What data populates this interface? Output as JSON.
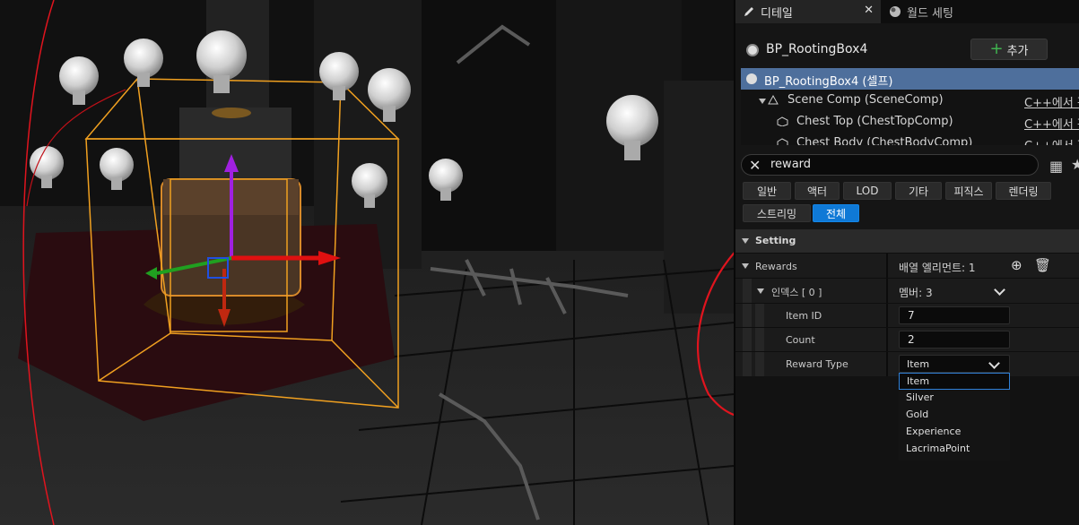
{
  "tabs": [
    {
      "label": "디테일",
      "active": true,
      "icon": "pencil-icon"
    },
    {
      "label": "월드 세팅",
      "active": false,
      "icon": "globe-icon"
    }
  ],
  "object": {
    "name": "BP_RootingBox4",
    "add_label": "추가"
  },
  "components": [
    {
      "label": "BP_RootingBox4 (셀프)",
      "selected": true,
      "cpp": ""
    },
    {
      "label": "Scene Comp (SceneComp)",
      "selected": false,
      "cpp": "C++에서 편"
    },
    {
      "label": "Chest Top (ChestTopComp)",
      "selected": false,
      "cpp": "C++에서 편"
    },
    {
      "label": "Chest Body (ChestBodyComp)",
      "selected": false,
      "cpp": "C++에서 편"
    }
  ],
  "search": {
    "value": "reward"
  },
  "filters": [
    "일반",
    "액터",
    "LOD",
    "기타",
    "피직스",
    "렌더링",
    "스트리밍",
    "전체"
  ],
  "active_filter": "전체",
  "section": "Setting",
  "properties": {
    "rewards_label": "Rewards",
    "rewards_value": "배열 엘리먼트: 1",
    "index_label": "인덱스 [ 0 ]",
    "index_value": "멤버: 3",
    "item_id_label": "Item ID",
    "item_id_value": "7",
    "count_label": "Count",
    "count_value": "2",
    "reward_type_label": "Reward Type",
    "reward_type_value": "Item"
  },
  "reward_type_options": [
    "Item",
    "Silver",
    "Gold",
    "Experience",
    "LacrimaPoint"
  ],
  "colors": {
    "accent": "#0f79d6",
    "selection": "#4e6f9c",
    "annotation": "#e0141e"
  }
}
